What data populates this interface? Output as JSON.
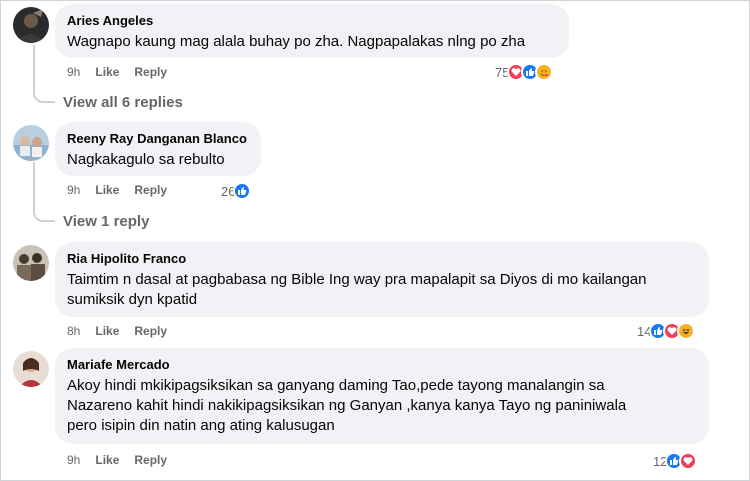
{
  "comments": [
    {
      "author": "Aries Angeles",
      "text_lines": [
        "Wagnapo kaung mag alala buhay po zha. Nagpapalakas nlng po zha"
      ],
      "time": "9h",
      "like_label": "Like",
      "reply_label": "Reply",
      "reaction_count": "75",
      "reactions": [
        "heart",
        "like",
        "care"
      ],
      "view_replies": "View all 6 replies"
    },
    {
      "author": "Reeny Ray Danganan Blanco",
      "text_lines": [
        "Nagkakagulo sa rebulto"
      ],
      "time": "9h",
      "like_label": "Like",
      "reply_label": "Reply",
      "reaction_count": "26",
      "reactions": [
        "like"
      ],
      "view_replies": "View 1 reply"
    },
    {
      "author": "Ria Hipolito Franco",
      "text_lines": [
        "Taimtim n dasal at pagbabasa ng Bible Ing way pra mapalapit sa Diyos di mo kailangan",
        "sumiksik dyn kpatid"
      ],
      "time": "8h",
      "like_label": "Like",
      "reply_label": "Reply",
      "reaction_count": "14",
      "reactions": [
        "like",
        "heart",
        "haha"
      ]
    },
    {
      "author": "Mariafe Mercado",
      "text_lines": [
        "Akoy hindi mkikipagsiksikan sa ganyang daming Tao,pede tayong manalangin sa",
        "Nazareno kahit hindi nakikipagsiksikan ng Ganyan ,kanya kanya Tayo ng paniniwala",
        "pero isipin din natin ang ating kalusugan"
      ],
      "time": "9h",
      "like_label": "Like",
      "reply_label": "Reply",
      "reaction_count": "12",
      "reactions": [
        "like",
        "heart"
      ]
    }
  ],
  "colors": {
    "bubble": "#f0f2f5",
    "meta_text": "#65676b",
    "like_blue": "#1877f2",
    "heart_red": "#f33e58",
    "haha_yellow": "#f7b125"
  }
}
